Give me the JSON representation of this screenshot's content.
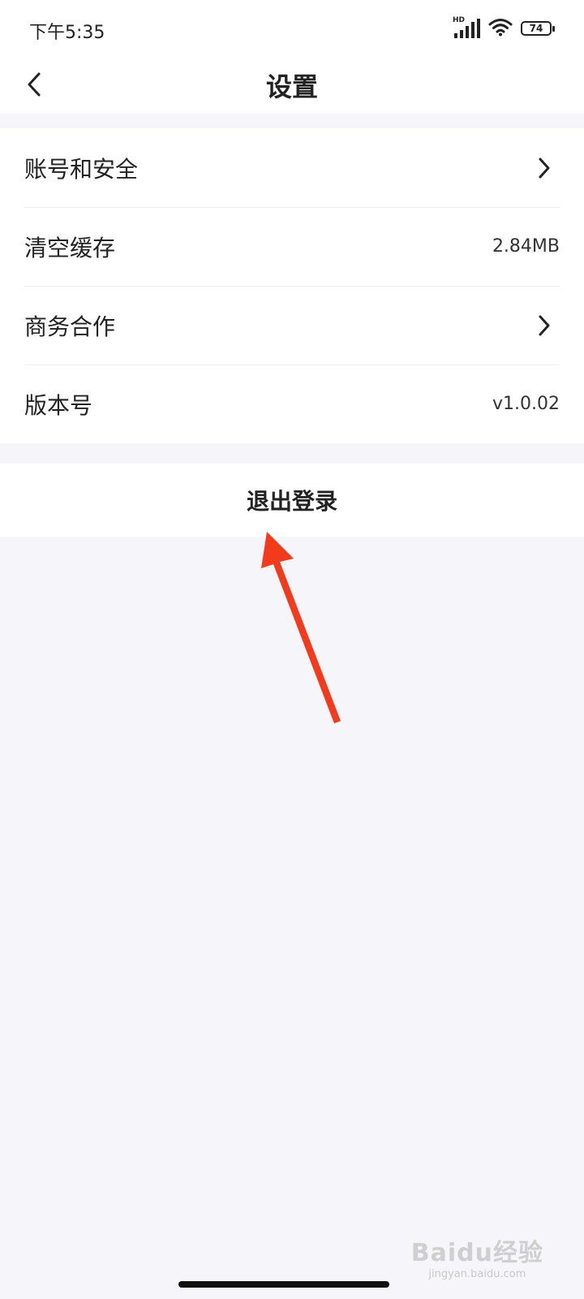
{
  "status_bar": {
    "time": "下午5:35",
    "network_label": "HD",
    "battery_level": "74",
    "battery_percent": 74
  },
  "header": {
    "title": "设置",
    "back_icon": "chevron-left-icon"
  },
  "settings": {
    "items": [
      {
        "label": "账号和安全",
        "value": "",
        "icon": "chevron-right-icon"
      },
      {
        "label": "清空缓存",
        "value": "2.84MB",
        "icon": ""
      },
      {
        "label": "商务合作",
        "value": "",
        "icon": "chevron-right-icon"
      },
      {
        "label": "版本号",
        "value": "v1.0.02",
        "icon": ""
      }
    ]
  },
  "logout": {
    "label": "退出登录"
  },
  "annotation": {
    "color": "#f23a1c",
    "icon": "arrow-up-icon"
  },
  "watermark": {
    "logo": "Baidu经验",
    "url": "jingyan.baidu.com"
  },
  "colors": {
    "background": "#f5f5fa",
    "card": "#ffffff",
    "text": "#222222"
  }
}
